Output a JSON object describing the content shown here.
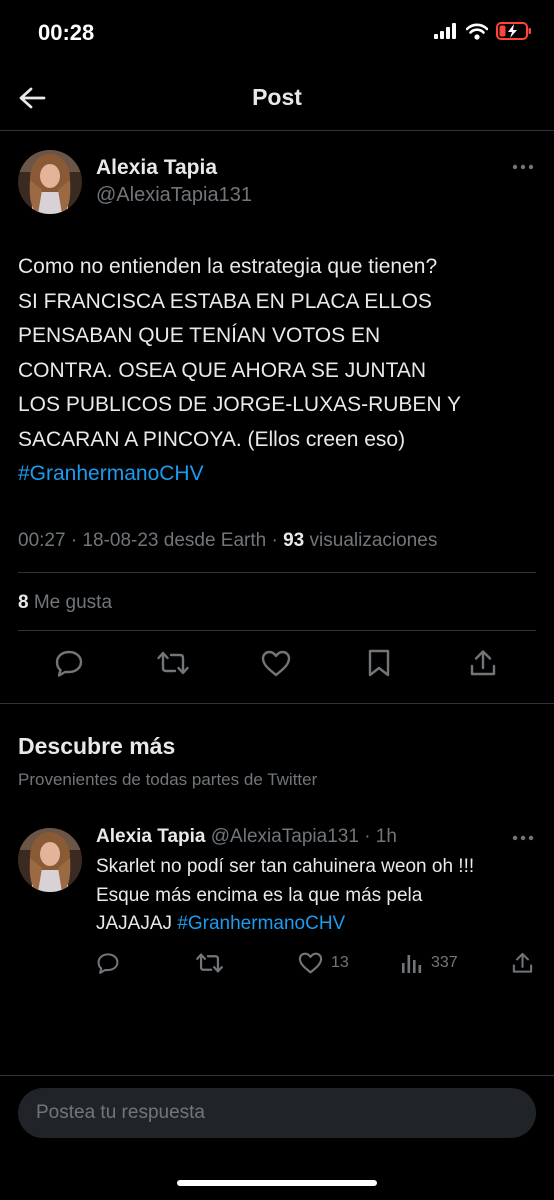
{
  "status_bar": {
    "time": "00:28",
    "icons": [
      "signal-icon",
      "wifi-icon",
      "battery-charging-icon"
    ]
  },
  "header": {
    "back_icon": "arrow-left-icon",
    "title": "Post"
  },
  "post": {
    "author_name": "Alexia Tapia",
    "author_handle": "@AlexiaTapia131",
    "text_lines": [
      "Como no entienden la estrategia que tienen?",
      "SI FRANCISCA ESTABA EN PLACA ELLOS",
      "PENSABAN QUE TENÍAN VOTOS EN",
      "CONTRA. OSEA QUE AHORA SE JUNTAN",
      "LOS PUBLICOS DE JORGE-LUXAS-RUBEN Y",
      "SACARAN A PINCOYA. (Ellos creen eso)"
    ],
    "hashtag": "#GranhermanoCHV",
    "meta_time": "00:27 · 18-08-23 desde Earth · ",
    "views_count": "93",
    "views_label": " visualizaciones",
    "likes_count": "8",
    "likes_label": " Me gusta",
    "actions": [
      "reply-icon",
      "retweet-icon",
      "like-icon",
      "bookmark-icon",
      "share-icon"
    ]
  },
  "discover": {
    "title": "Descubre más",
    "subtitle": "Provenientes de todas partes de Twitter"
  },
  "recommended": {
    "author_name": "Alexia Tapia",
    "handle_time": " @AlexiaTapia131 · 1h",
    "text_lines": [
      "Skarlet no podí ser tan cahuinera weon oh !!!",
      "Esque más encima es la que más pela"
    ],
    "text_last": "JAJAJAJ ",
    "hashtag": "#GranhermanoCHV",
    "likes": "13",
    "views": "337"
  },
  "reply": {
    "placeholder": "Postea tu respuesta"
  },
  "colors": {
    "background": "#000000",
    "text": "#e7e9ea",
    "muted": "#71767b",
    "link": "#1d9bf0",
    "divider": "#2f3336",
    "input_bg": "#202327"
  }
}
